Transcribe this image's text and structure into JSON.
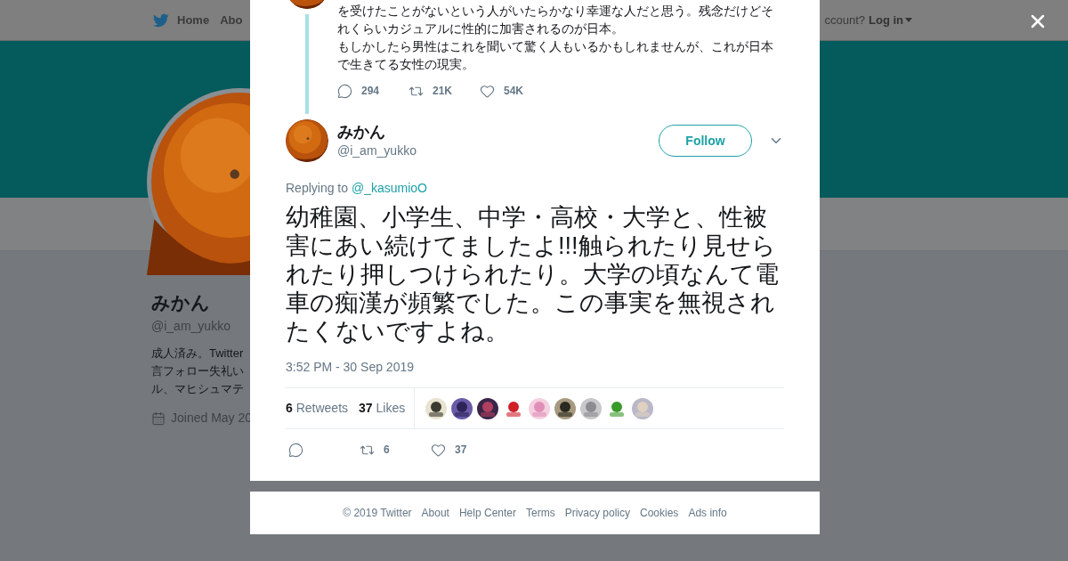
{
  "nav": {
    "items": [
      {
        "label": "Home",
        "kind": "home"
      },
      {
        "label": "Abo",
        "kind": "plain"
      }
    ],
    "account_prompt": "ccount?",
    "login": "Log in"
  },
  "profile": {
    "name": "みかん",
    "handle": "@i_am_yukko",
    "bio_lines": [
      "成人済み。Twitter",
      "言フォロー失礼い",
      "ル、マヒシュマテ"
    ],
    "joined": "Joined May 20"
  },
  "previous_tweet": {
    "paragraphs": [
      "を受けたことがないという人がいたらかなり幸運な人だと思う。残念だけどそれくらいカジュアルに性的に加害されるのが日本。",
      "もしかしたら男性はこれを聞いて驚く人もいるかもしれませんが、これが日本で生きてる女性の現実。"
    ],
    "actions": [
      {
        "kind": "reply",
        "count": "294"
      },
      {
        "kind": "retweet",
        "count": "21K"
      },
      {
        "kind": "like",
        "count": "54K"
      }
    ]
  },
  "tweet": {
    "name": "みかん",
    "handle": "@i_am_yukko",
    "follow": "Follow",
    "replying_prefix": "Replying to",
    "replying_to": "@_kasumioO",
    "text": "幼稚園、小学生、中学・高校・大学と、性被害にあい続けてましたよ!!!触られたり見せられたり押しつけられたり。大学の頃なんて電車の痴漢が頻繁でした。この事実を無視されたくないですよね。",
    "timestamp": "3:52 PM - 30 Sep 2019",
    "stats": [
      {
        "count": "6",
        "label": "Retweets"
      },
      {
        "count": "37",
        "label": "Likes"
      }
    ],
    "actions": [
      {
        "kind": "reply"
      },
      {
        "kind": "retweet",
        "count": "6"
      },
      {
        "kind": "like",
        "count": "37"
      }
    ]
  },
  "footer": {
    "links": [
      "© 2019 Twitter",
      "About",
      "Help Center",
      "Terms",
      "Privacy policy",
      "Cookies",
      "Ads info"
    ]
  }
}
